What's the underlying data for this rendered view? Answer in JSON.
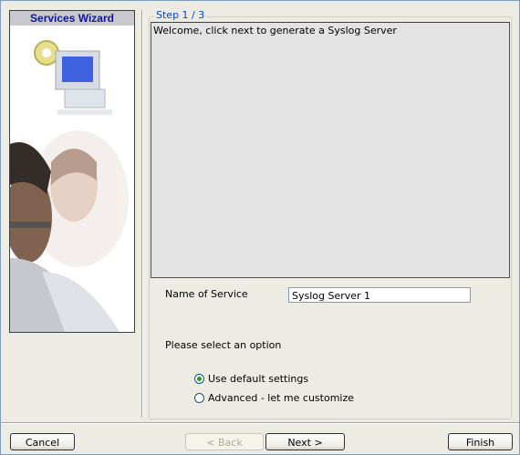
{
  "wizard": {
    "banner_title": "Services Wizard",
    "step_legend": "Step 1 / 3",
    "message": "Welcome, click next to generate a Syslog Server",
    "name_label": "Name of Service",
    "name_value": "Syslog Server 1",
    "option_prompt": "Please select an option",
    "options": [
      {
        "label": "Use default settings",
        "checked": true
      },
      {
        "label": "Advanced - let me customize",
        "checked": false
      }
    ]
  },
  "buttons": {
    "cancel": "Cancel",
    "back": "< Back",
    "next": "Next >",
    "finish": "Finish"
  }
}
